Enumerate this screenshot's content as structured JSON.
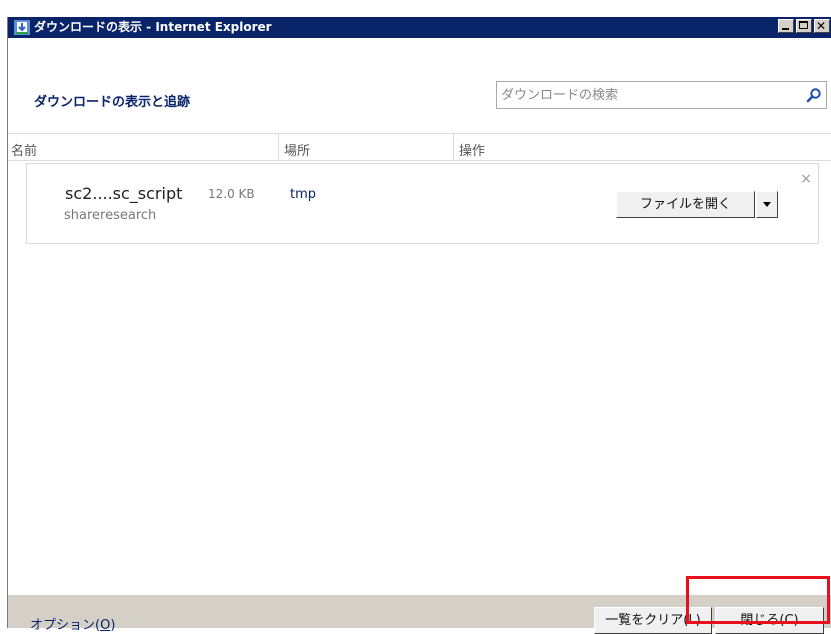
{
  "window": {
    "title": "ダウンロードの表示 - Internet Explorer"
  },
  "header": {
    "title": "ダウンロードの表示と追跡",
    "search_placeholder": "ダウンロードの検索"
  },
  "columns": [
    "名前",
    "場所",
    "操作"
  ],
  "downloads": [
    {
      "name": "sc2....sc_script",
      "size": "12.0 KB",
      "source": "shareresearch",
      "location": "tmp",
      "action_label": "ファイルを開く",
      "dismiss": "×"
    }
  ],
  "footer": {
    "options_label": "オプション(",
    "options_key": "O",
    "options_end": ")",
    "clear_label": "一覧をクリア(L)",
    "close_label": "閉じる(C)"
  },
  "colors": {
    "titlebar": "#0a246a",
    "link": "#0a246a",
    "highlight": "#e8101c"
  },
  "icons": [
    "ie-download-icon",
    "minimize-icon",
    "maximize-icon",
    "close-icon",
    "search-icon",
    "chevron-down-icon"
  ]
}
